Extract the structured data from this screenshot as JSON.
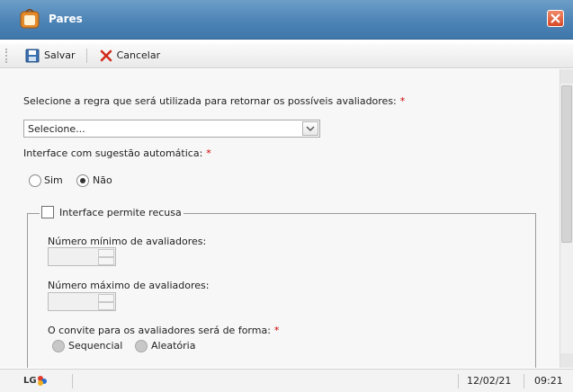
{
  "window": {
    "title": "Pares"
  },
  "toolbar": {
    "save_label": "Salvar",
    "cancel_label": "Cancelar"
  },
  "form": {
    "rule_label": "Selecione a regra que será utilizada para retornar os possíveis avaliadores:",
    "required_mark": "*",
    "rule_select_value": "Selecione...",
    "suggestion_label": "Interface com sugestão automática:",
    "radio_sim": "Sim",
    "radio_nao": "Não",
    "refusal_label": "Interface permite recusa",
    "min_label": "Número mínimo de avaliadores:",
    "max_label": "Número máximo de avaliadores:",
    "invite_label": "O convite para os avaliadores será de forma:",
    "radio_sequencial": "Sequencial",
    "radio_aleatoria": "Aleatória"
  },
  "status": {
    "logo_text": "LG",
    "date": "12/02/21",
    "time": "09:21"
  },
  "colors": {
    "required": "#cc0000",
    "title_bar": "#4d84b6"
  }
}
